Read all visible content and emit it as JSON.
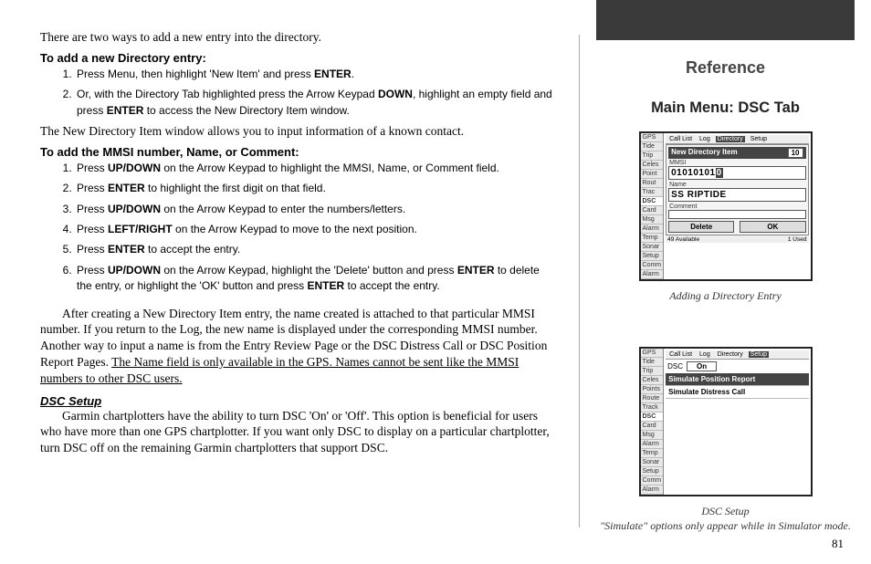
{
  "left": {
    "intro": "There are two ways to add a new entry into the directory.",
    "h1": "To add a new Directory entry:",
    "l1": {
      "s1a": "Press Menu, then highlight 'New Item' and press ",
      "s1b": "ENTER",
      "s1c": ".",
      "s2a": "Or, with the Directory Tab highlighted press the Arrow Keypad ",
      "s2b": "DOWN",
      "s2c": ", highlight an empty field and press ",
      "s2d": "ENTER",
      "s2e": " to access the New Directory Item window."
    },
    "note1": "The New Directory Item window allows you to input information of a known contact.",
    "h2": "To add the MMSI number, Name, or Comment:",
    "l2": {
      "s1a": "Press ",
      "s1b": "UP/DOWN",
      "s1c": " on the Arrow Keypad to highlight the MMSI, Name, or Comment field.",
      "s2a": "Press ",
      "s2b": "ENTER",
      "s2c": " to highlight the first digit on that field.",
      "s3a": "Press ",
      "s3b": "UP/DOWN",
      "s3c": " on the Arrow Keypad to enter the numbers/letters.",
      "s4a": "Press ",
      "s4b": "LEFT/RIGHT",
      "s4c": " on the Arrow Keypad to move to the next position.",
      "s5a": "Press ",
      "s5b": "ENTER",
      "s5c": " to accept the entry.",
      "s6a": "Press ",
      "s6b": "UP/DOWN",
      "s6c": " on the Arrow Keypad, highlight the 'Delete' button and press ",
      "s6d": "ENTER",
      "s6e": " to delete the entry, or highlight the 'OK' button and press ",
      "s6f": "ENTER",
      "s6g": " to accept the entry."
    },
    "para2a": "After creating a New Directory Item entry, the name created is attached to that particular MMSI number. If you return to the Log, the new name is displayed under the corresponding MMSI number. Another way to input a name is from the Entry Review Page or the DSC Distress Call or DSC Position Report Pages. ",
    "para2u": "The Name field is only available in the GPS. Names cannot be sent like the MMSI numbers to other DSC users.",
    "h3": "DSC Setup",
    "para3": "Garmin chartplotters have the ability to turn DSC 'On' or 'Off'. This option is beneficial for users who have more than one GPS chartplotter. If you want only DSC to display on a particular chartplotter, turn DSC off on the remaining Garmin chartplotters that support DSC."
  },
  "right": {
    "ref": "Reference",
    "sub": "Main Menu: DSC Tab",
    "cap1": "Adding a Directory Entry",
    "cap2a": "DSC Setup",
    "cap2b": "\"Simulate\" options only appear while in Simulator mode.",
    "pagenum": "81"
  },
  "device1": {
    "tabs": [
      "GPS",
      "Tide",
      "Trip",
      "Celes",
      "Point",
      "Rout",
      "Trac",
      "DSC",
      "Card",
      "Msg",
      "Alarm",
      "Temp",
      "Sonar",
      "Setup",
      "Comm",
      "Alarm"
    ],
    "selTab": "DSC",
    "topTabs": [
      "Call List",
      "Log",
      "Directory",
      "Setup"
    ],
    "topSel": "Directory",
    "panelTitle": "New Directory Item",
    "panelNum": "10",
    "labelMmsi": "MMSI",
    "mmsi": "01010101",
    "mmsiCursor": "0",
    "labelName": "Name",
    "name": "SS RIPTIDE",
    "labelComment": "Comment",
    "btnDelete": "Delete",
    "btnOk": "OK",
    "statusL": "49  Available",
    "statusR": "1  Used"
  },
  "device2": {
    "tabs": [
      "GPS",
      "Tide",
      "Trip",
      "Celes",
      "Points",
      "Route",
      "Track",
      "DSC",
      "Card",
      "Msg",
      "Alarm",
      "Temp",
      "Sonar",
      "Setup",
      "Comm",
      "Alarm"
    ],
    "selTab": "DSC",
    "topTabs": [
      "Call List",
      "Log",
      "Directory",
      "Setup"
    ],
    "topSel": "Setup",
    "dscLabel": "DSC",
    "dscVal": "On",
    "item1": "Simulate Position Report",
    "item2": "Simulate Distress Call"
  }
}
